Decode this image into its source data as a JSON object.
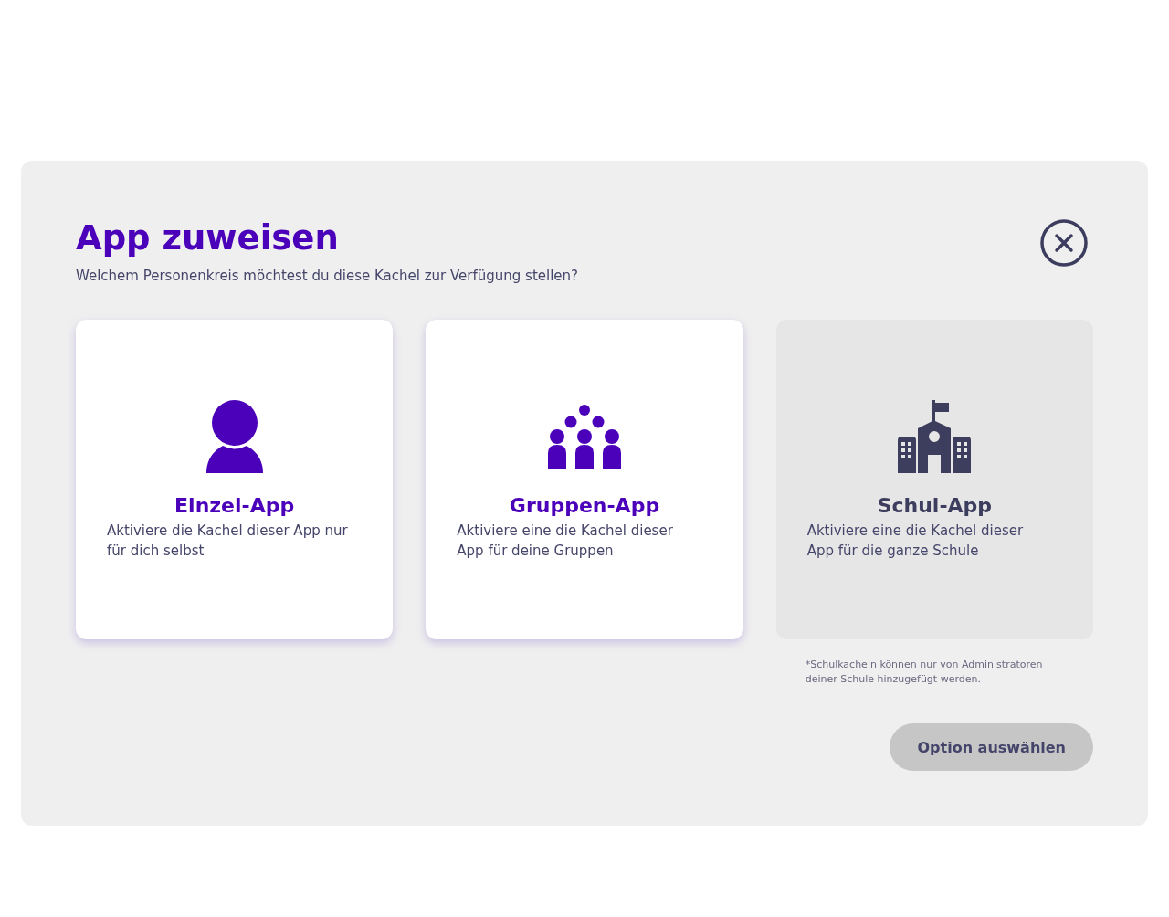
{
  "dialog": {
    "title": "App zuweisen",
    "subtitle": "Welchem Personenkreis möchtest du diese Kachel zur Verfügung stellen?"
  },
  "options": [
    {
      "kind": "person",
      "title": "Einzel-App",
      "description": "Aktiviere die Kachel dieser App nur für dich selbst",
      "selected": false,
      "disabled": false
    },
    {
      "kind": "group",
      "title": "Gruppen-App",
      "description": "Aktiviere eine die Kachel dieser App für deine Gruppen",
      "selected": false,
      "disabled": false
    },
    {
      "kind": "school",
      "title": "Schul-App",
      "description": "Aktiviere eine die Kachel dieser App für die ganze Schule",
      "selected": false,
      "disabled": true
    }
  ],
  "footnote": "*Schulkacheln können nur von Administratoren deiner Schule hinzugefügt werden.",
  "confirm_button": {
    "label": "Option auswählen",
    "disabled": true
  }
}
